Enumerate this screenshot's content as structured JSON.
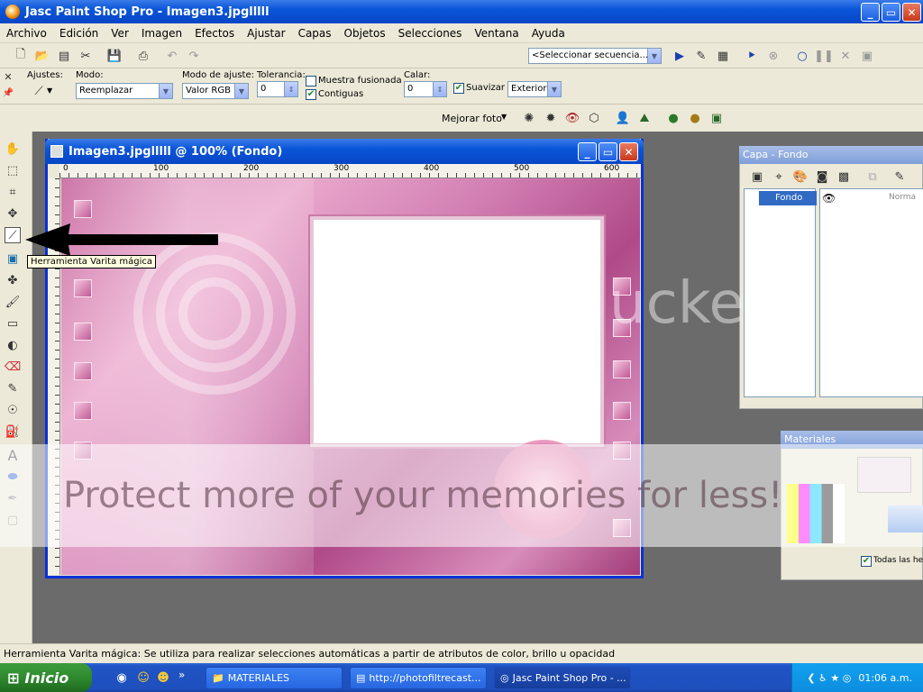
{
  "title_bar": {
    "title": "Jasc Paint Shop Pro - Imagen3.jpglllll",
    "minimize": "_",
    "maximize": "▭",
    "close": "✕"
  },
  "menu": [
    "Archivo",
    "Edición",
    "Ver",
    "Imagen",
    "Efectos",
    "Ajustar",
    "Capas",
    "Objetos",
    "Selecciones",
    "Ventana",
    "Ayuda"
  ],
  "script_toolbar": {
    "sequence_select": "<Seleccionar secuencia..."
  },
  "tool_options": {
    "presets_label": "Ajustes:",
    "mode_label": "Modo:",
    "mode_value": "Reemplazar",
    "match_mode_label": "Modo de ajuste:",
    "match_mode_value": "Valor RGB",
    "tolerance_label": "Tolerancia:",
    "tolerance_value": "0",
    "sample_merged_label": "Muestra fusionada",
    "contiguous_label": "Contiguas",
    "feather_label": "Calar:",
    "feather_value": "0",
    "antialias_label": "Suavizar",
    "antialias_value": "Exterior"
  },
  "photo_toolbar": {
    "enhance_label": "Mejorar foto"
  },
  "image_window": {
    "title": "Imagen3.jpglllll @ 100% (Fondo)"
  },
  "ruler": {
    "top_ticks": [
      "0",
      "100",
      "200",
      "300",
      "400",
      "500",
      "600"
    ]
  },
  "tooltip": "Herramienta Varita mágica",
  "watermark": {
    "main": "Protect more of your memories for less!",
    "brand": "ucke"
  },
  "layers_palette": {
    "title": "Capa - Fondo",
    "layer_name": "Fondo",
    "blend_mode": "Norma"
  },
  "materials_palette": {
    "title": "Materiales",
    "all_tools_label": "Todas las her"
  },
  "status_text": "Herramienta Varita mágica: Se utiliza para realizar selecciones automáticas a partir de atributos de color, brillo u opacidad",
  "taskbar": {
    "start": "Inicio",
    "tasks": [
      "MATERIALES",
      "http://photofiltrecast...",
      "Jasc Paint Shop Pro - ..."
    ],
    "clock": "01:06 a.m."
  }
}
